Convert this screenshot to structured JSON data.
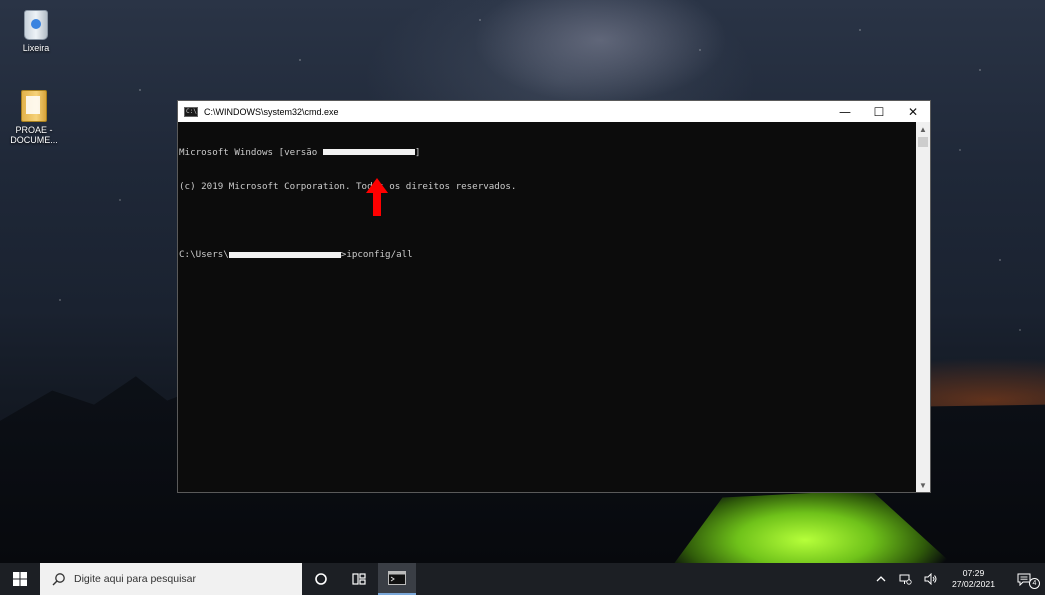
{
  "desktop": {
    "icons": [
      {
        "label": "Lixeira",
        "icon": "recycle-bin-icon"
      },
      {
        "label": "PROAE -\nDOCUME...",
        "icon": "folder-icon"
      }
    ]
  },
  "window": {
    "title": "C:\\WINDOWS\\system32\\cmd.exe",
    "icon": "cmd-icon",
    "controls": {
      "minimize": "—",
      "maximize": "☐",
      "close": "✕"
    }
  },
  "console": {
    "line1_prefix": "Microsoft Windows [versão ",
    "line1_suffix": "]",
    "line2": "(c) 2019 Microsoft Corporation. Todos os direitos reservados.",
    "prompt_prefix": "C:\\Users\\",
    "prompt_suffix": ">ipconfig/all"
  },
  "annotation": {
    "arrow_color": "#ff0000"
  },
  "taskbar": {
    "start_icon": "windows-logo-icon",
    "search_placeholder": "Digite aqui para pesquisar",
    "clock_time": "07:29",
    "clock_date": "27/02/2021",
    "notification_count": "4"
  },
  "colors": {
    "console_bg": "#0c0c0c",
    "console_text": "#cccccc",
    "taskbar_bg": "#1c1f24"
  }
}
